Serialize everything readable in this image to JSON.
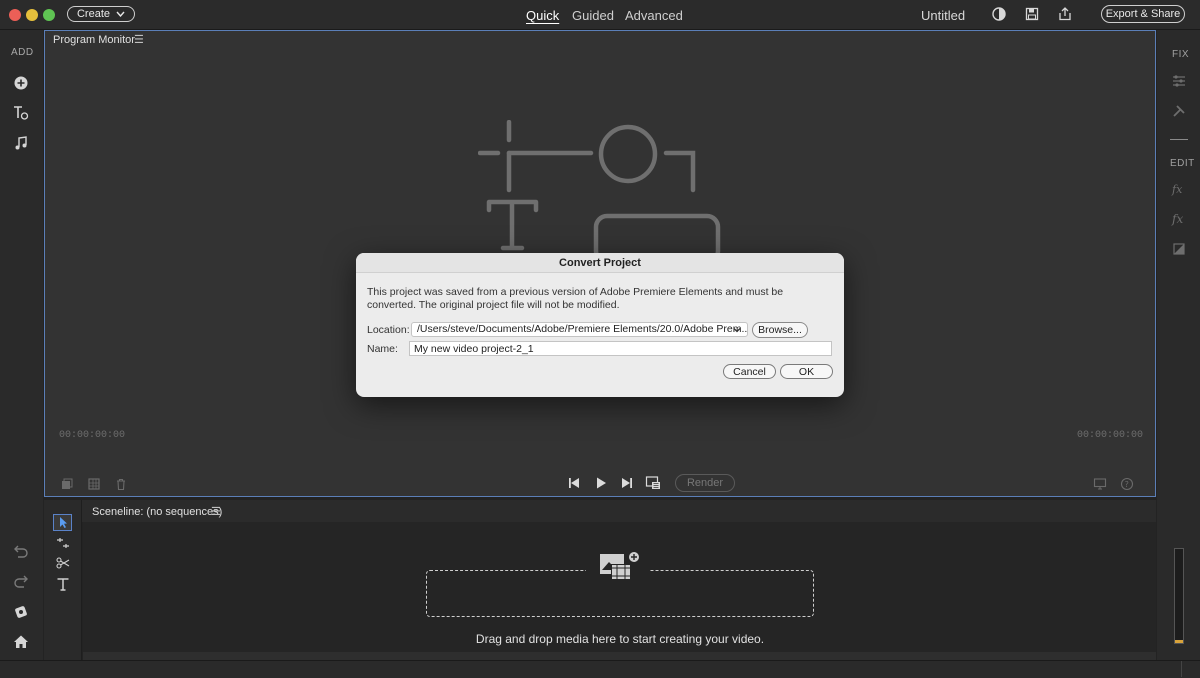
{
  "window": {
    "title": "Untitled",
    "traffic_lights": {
      "close": "#ec5f57",
      "minimize": "#e5bf3c",
      "maximize": "#5fc453"
    }
  },
  "topbar": {
    "create_label": "Create",
    "modes": [
      "Quick",
      "Guided",
      "Advanced"
    ],
    "active_mode": "Quick",
    "export_label": "Export & Share"
  },
  "left_panel": {
    "label": "ADD"
  },
  "right_panel": {
    "fix_label": "FIX",
    "edit_label": "EDIT"
  },
  "monitor": {
    "title": "Program Monitor",
    "timecode_left": "00:00:00:00",
    "timecode_right": "00:00:00:00",
    "render_label": "Render"
  },
  "sceneline": {
    "title": "Sceneline: (no sequences)",
    "drop_text": "Drag and drop media here to start creating your video."
  },
  "dialog": {
    "title": "Convert Project",
    "message": "This project was saved from a previous version of Adobe Premiere Elements and must be converted. The original project file will not be modified.",
    "location_label": "Location:",
    "location_value": "/Users/steve/Documents/Adobe/Premiere Elements/20.0/Adobe Prem...",
    "browse_label": "Browse...",
    "name_label": "Name:",
    "name_value": "My new video project-2_1",
    "cancel_label": "Cancel",
    "ok_label": "OK"
  },
  "colors": {
    "accent_border": "#5b7fb8",
    "meter": "#d9a33a"
  }
}
